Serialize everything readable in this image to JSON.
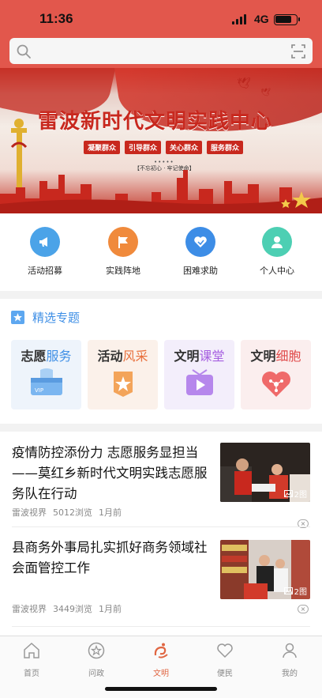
{
  "status_bar": {
    "time": "11:36",
    "network": "4G"
  },
  "search": {
    "placeholder": ""
  },
  "banner": {
    "title": "雷波新时代文明实践中心",
    "tags": [
      "凝聚群众",
      "引导群众",
      "关心群众",
      "服务群众"
    ],
    "motto": "【不忘初心 · 牢记使命】"
  },
  "quick_menu": [
    {
      "label": "活动招募",
      "icon": "megaphone-icon",
      "color": "#4ba3e8"
    },
    {
      "label": "实践阵地",
      "icon": "flag-icon",
      "color": "#f08a3c"
    },
    {
      "label": "困难求助",
      "icon": "heart-hand-icon",
      "color": "#3d8de6"
    },
    {
      "label": "个人中心",
      "icon": "user-icon",
      "color": "#4dcfb3"
    }
  ],
  "featured": {
    "title": "精选专题",
    "cards": [
      {
        "prefix": "志愿",
        "highlight": "服务",
        "highlight_color": "#3f8fe6",
        "bg": "#eef4fb",
        "icon": "vip-card-icon"
      },
      {
        "prefix": "活动",
        "highlight": "风采",
        "highlight_color": "#e8703c",
        "bg": "#fbf1ea",
        "icon": "star-badge-icon"
      },
      {
        "prefix": "文明",
        "highlight": "课堂",
        "highlight_color": "#a65fe0",
        "bg": "#f3eefb",
        "icon": "video-play-icon"
      },
      {
        "prefix": "文明",
        "highlight": "细胞",
        "highlight_color": "#e04a4a",
        "bg": "#fbeeee",
        "icon": "heart-cell-icon"
      }
    ]
  },
  "news": [
    {
      "title": "疫情防控添份力 志愿服务显担当——莫红乡新时代文明实践志愿服务队在行动",
      "source": "雷波视界",
      "views": "5012浏览",
      "time": "1月前",
      "image_count": "2图"
    },
    {
      "title": "县商务外事局扎实抓好商务领域社会面管控工作",
      "source": "雷波视界",
      "views": "3449浏览",
      "time": "1月前",
      "image_count": "2图"
    }
  ],
  "tabbar": [
    {
      "label": "首页",
      "icon": "home-icon",
      "active": false
    },
    {
      "label": "问政",
      "icon": "star-chat-icon",
      "active": false
    },
    {
      "label": "文明",
      "icon": "civilization-logo-icon",
      "active": true
    },
    {
      "label": "便民",
      "icon": "heart-icon",
      "active": false
    },
    {
      "label": "我的",
      "icon": "user-icon",
      "active": false
    }
  ]
}
